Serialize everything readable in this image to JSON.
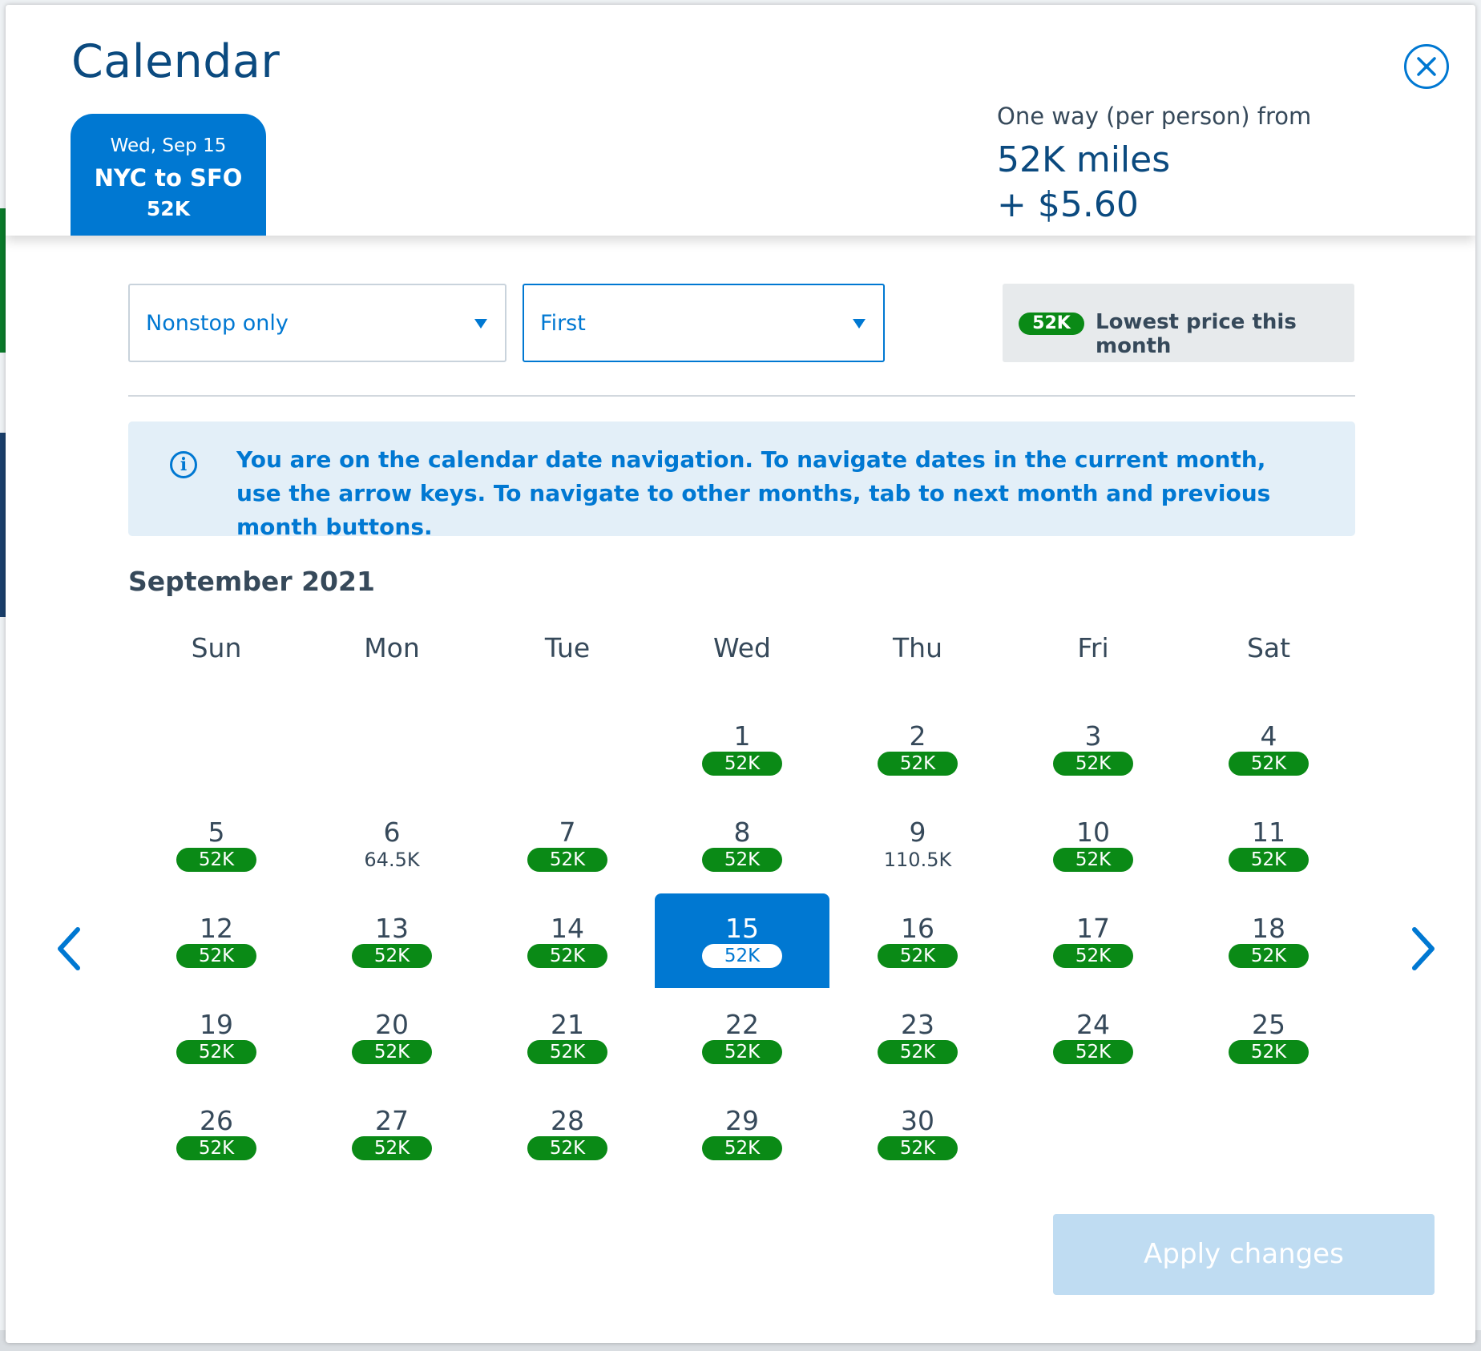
{
  "modal": {
    "title": "Calendar",
    "close_icon": "close-icon"
  },
  "trip_tab": {
    "date": "Wed, Sep 15",
    "route": "NYC to SFO",
    "price": "52K"
  },
  "fare": {
    "label": "One way (per person) from",
    "miles": "52K miles",
    "fee": "+ $5.60"
  },
  "filters": {
    "stops": {
      "value": "Nonstop only"
    },
    "cabin": {
      "value": "First"
    }
  },
  "legend": {
    "pill": "52K",
    "text": "Lowest price this month"
  },
  "info": {
    "icon": "info-icon",
    "text": "You are on the calendar date navigation. To navigate dates in the current month, use the arrow keys. To navigate to other months, tab to next month and previous month buttons."
  },
  "calendar": {
    "month": "September 2021",
    "weekdays": [
      "Sun",
      "Mon",
      "Tue",
      "Wed",
      "Thu",
      "Fri",
      "Sat"
    ],
    "days": [
      {
        "day": "1",
        "price": "52K",
        "lowest": true
      },
      {
        "day": "2",
        "price": "52K",
        "lowest": true
      },
      {
        "day": "3",
        "price": "52K",
        "lowest": true
      },
      {
        "day": "4",
        "price": "52K",
        "lowest": true
      },
      {
        "day": "5",
        "price": "52K",
        "lowest": true
      },
      {
        "day": "6",
        "price": "64.5K",
        "lowest": false
      },
      {
        "day": "7",
        "price": "52K",
        "lowest": true
      },
      {
        "day": "8",
        "price": "52K",
        "lowest": true
      },
      {
        "day": "9",
        "price": "110.5K",
        "lowest": false
      },
      {
        "day": "10",
        "price": "52K",
        "lowest": true
      },
      {
        "day": "11",
        "price": "52K",
        "lowest": true
      },
      {
        "day": "12",
        "price": "52K",
        "lowest": true
      },
      {
        "day": "13",
        "price": "52K",
        "lowest": true
      },
      {
        "day": "14",
        "price": "52K",
        "lowest": true
      },
      {
        "day": "15",
        "price": "52K",
        "lowest": true,
        "selected": true
      },
      {
        "day": "16",
        "price": "52K",
        "lowest": true
      },
      {
        "day": "17",
        "price": "52K",
        "lowest": true
      },
      {
        "day": "18",
        "price": "52K",
        "lowest": true
      },
      {
        "day": "19",
        "price": "52K",
        "lowest": true
      },
      {
        "day": "20",
        "price": "52K",
        "lowest": true
      },
      {
        "day": "21",
        "price": "52K",
        "lowest": true
      },
      {
        "day": "22",
        "price": "52K",
        "lowest": true
      },
      {
        "day": "23",
        "price": "52K",
        "lowest": true
      },
      {
        "day": "24",
        "price": "52K",
        "lowest": true
      },
      {
        "day": "25",
        "price": "52K",
        "lowest": true
      },
      {
        "day": "26",
        "price": "52K",
        "lowest": true
      },
      {
        "day": "27",
        "price": "52K",
        "lowest": true
      },
      {
        "day": "28",
        "price": "52K",
        "lowest": true
      },
      {
        "day": "29",
        "price": "52K",
        "lowest": true
      },
      {
        "day": "30",
        "price": "52K",
        "lowest": true
      }
    ],
    "prev_icon": "chevron-left-icon",
    "next_icon": "chevron-right-icon"
  },
  "actions": {
    "apply_label": "Apply changes"
  },
  "colors": {
    "brand_blue": "#0078d2",
    "navy": "#0b4a7f",
    "lowest_price_green": "#0a8a16",
    "apply_disabled": "#bfdcf2",
    "info_bg": "#e3eff8"
  }
}
